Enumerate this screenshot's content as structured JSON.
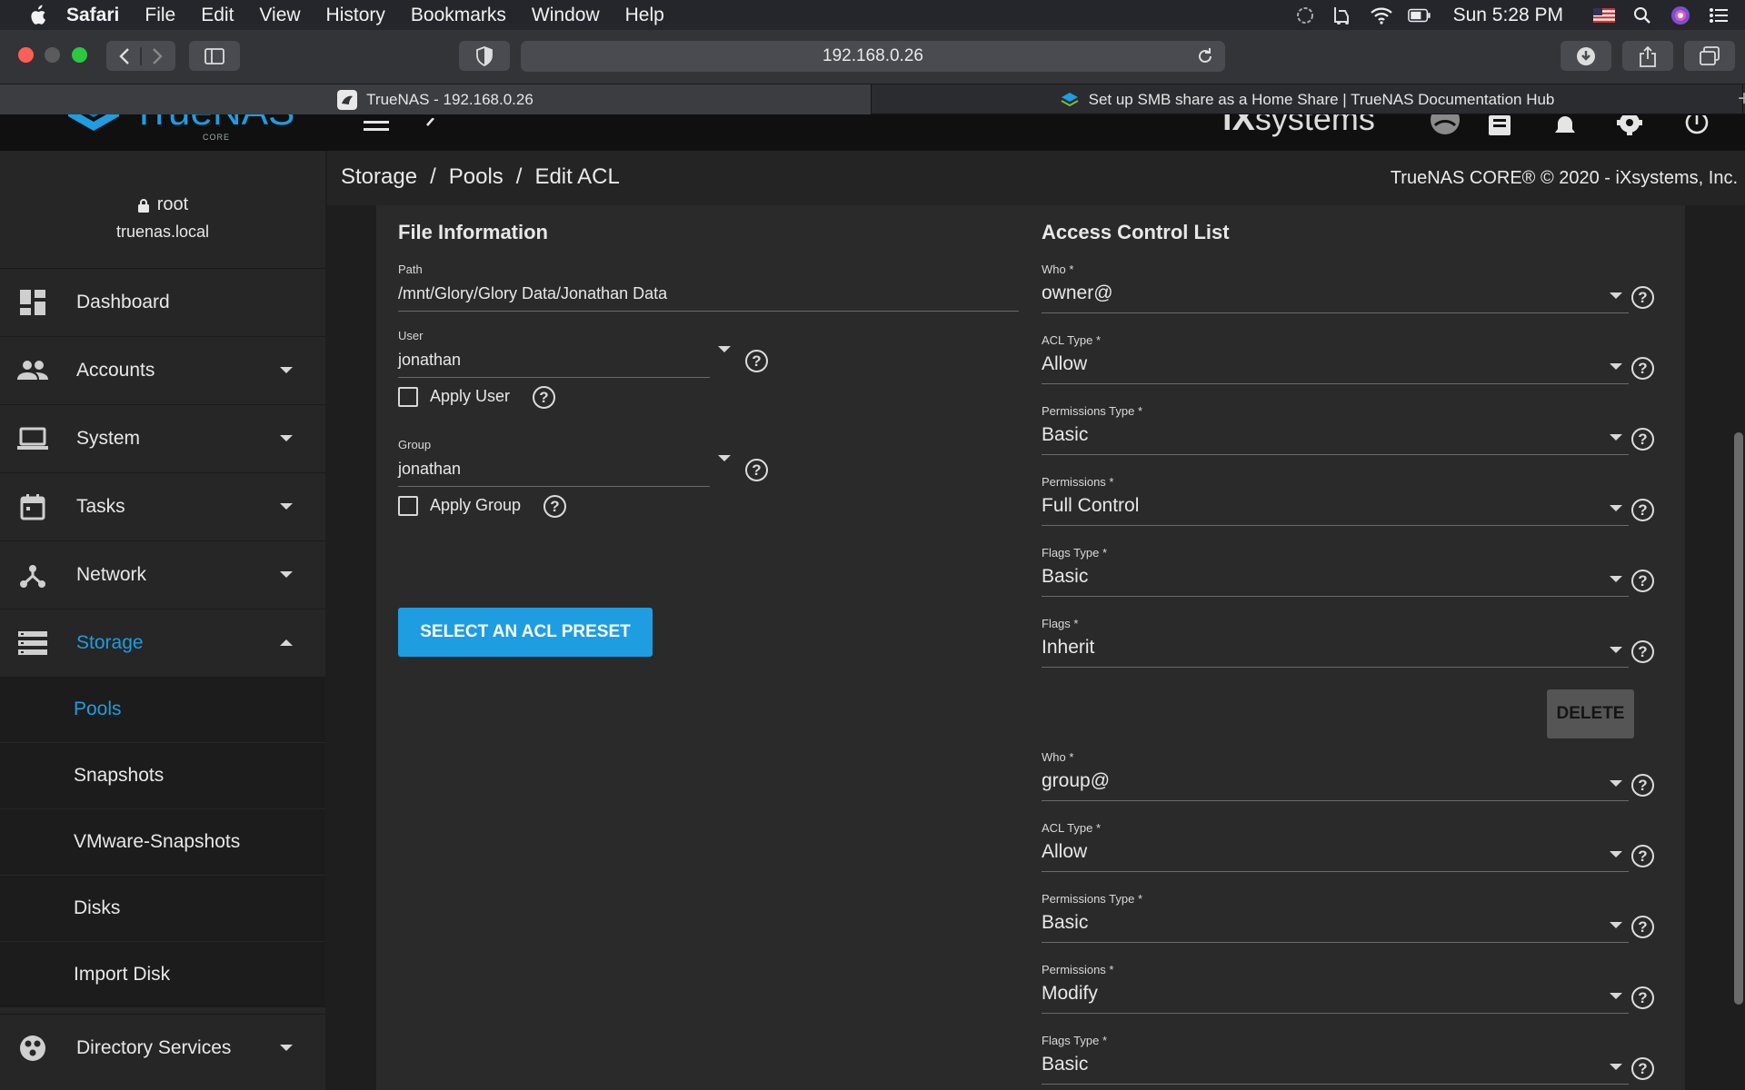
{
  "menubar": {
    "app": "Safari",
    "items": [
      "File",
      "Edit",
      "View",
      "History",
      "Bookmarks",
      "Window",
      "Help"
    ],
    "clock": "Sun 5:28 PM"
  },
  "browser": {
    "url": "192.168.0.26",
    "tabs": [
      {
        "label": "TrueNAS - 192.168.0.26",
        "active": true
      },
      {
        "label": "Set up SMB share as a Home Share | TrueNAS Documentation Hub",
        "active": false
      }
    ]
  },
  "header": {
    "logo_text": "TrueNAS",
    "logo_sub": "CORE",
    "vendor": "systems"
  },
  "breadcrumb": {
    "items": [
      "Storage",
      "Pools",
      "Edit ACL"
    ],
    "separator": "/",
    "copyright": "TrueNAS CORE® © 2020 - iXsystems, Inc."
  },
  "sidebar": {
    "user": "root",
    "host": "truenas.local",
    "nav": [
      {
        "label": "Dashboard",
        "icon": "dashboard-icon"
      },
      {
        "label": "Accounts",
        "icon": "people-icon"
      },
      {
        "label": "System",
        "icon": "laptop-icon"
      },
      {
        "label": "Tasks",
        "icon": "calendar-icon"
      },
      {
        "label": "Network",
        "icon": "network-icon"
      },
      {
        "label": "Storage",
        "icon": "storage-icon"
      }
    ],
    "storage_sub": [
      "Pools",
      "Snapshots",
      "VMware-Snapshots",
      "Disks",
      "Import Disk"
    ],
    "directory_services": "Directory Services"
  },
  "file_info": {
    "title": "File Information",
    "path_label": "Path",
    "path_value": "/mnt/Glory/Glory Data/Jonathan Data",
    "user_label": "User",
    "user_value": "jonathan",
    "apply_user": "Apply User",
    "group_label": "Group",
    "group_value": "jonathan",
    "apply_group": "Apply Group",
    "preset_button": "SELECT AN ACL PRESET"
  },
  "acl": {
    "title": "Access Control List",
    "delete_button": "DELETE",
    "entries": [
      {
        "who_label": "Who *",
        "who": "owner@",
        "type_label": "ACL Type *",
        "type": "Allow",
        "ptype_label": "Permissions Type *",
        "ptype": "Basic",
        "perm_label": "Permissions *",
        "perm": "Full Control",
        "ftype_label": "Flags Type *",
        "ftype": "Basic",
        "flags_label": "Flags *",
        "flags": "Inherit"
      },
      {
        "who_label": "Who *",
        "who": "group@",
        "type_label": "ACL Type *",
        "type": "Allow",
        "ptype_label": "Permissions Type *",
        "ptype": "Basic",
        "perm_label": "Permissions *",
        "perm": "Modify",
        "ftype_label": "Flags Type *",
        "ftype": "Basic"
      }
    ]
  },
  "colors": {
    "accent": "#1e9de0",
    "sidebar_bg": "#262626",
    "card_bg": "#2a2a2a"
  }
}
